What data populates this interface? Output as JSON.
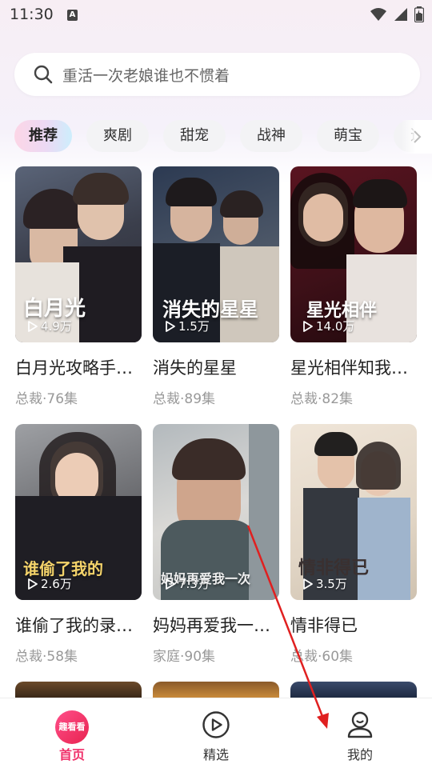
{
  "status_bar": {
    "time": "11:30",
    "notification_icon": "a-badge-icon"
  },
  "search": {
    "placeholder": "重活一次老娘谁也不惯着"
  },
  "tabs": [
    {
      "label": "推荐",
      "active": true
    },
    {
      "label": "爽剧"
    },
    {
      "label": "甜宠"
    },
    {
      "label": "战神"
    },
    {
      "label": "萌宝"
    },
    {
      "label": "逆"
    }
  ],
  "dramas": [
    {
      "title": "白月光攻略手…",
      "meta": "总裁·76集",
      "views": "4.9万",
      "poster_caption": "白月光"
    },
    {
      "title": "消失的星星",
      "meta": "总裁·89集",
      "views": "1.5万",
      "poster_caption": "消失的星星"
    },
    {
      "title": "星光相伴知我…",
      "meta": "总裁·82集",
      "views": "14.0万",
      "poster_caption": "星光相伴"
    },
    {
      "title": "谁偷了我的录…",
      "meta": "总裁·58集",
      "views": "2.6万",
      "poster_caption": "谁偷了我的"
    },
    {
      "title": "妈妈再爱我一…",
      "meta": "家庭·90集",
      "views": "7.3万",
      "poster_caption": "妈妈再爱我一次"
    },
    {
      "title": "情非得已",
      "meta": "总裁·60集",
      "views": "3.5万",
      "poster_caption": "情非得已"
    }
  ],
  "bottom_nav": {
    "home_badge": "趣看看",
    "home": "首页",
    "featured": "精选",
    "mine": "我的"
  },
  "colors": {
    "accent": "#f0306a",
    "annotation_arrow": "#e02020"
  }
}
